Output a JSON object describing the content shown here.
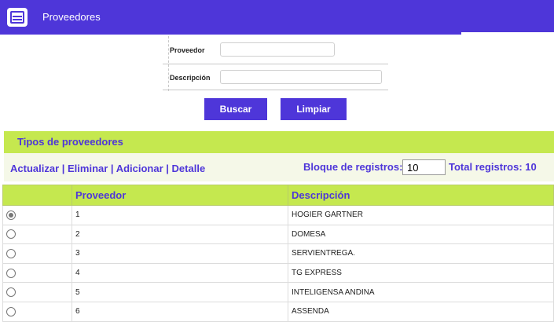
{
  "header": {
    "title": "Proveedores",
    "icon": "menu-document-icon",
    "color": "#4e36d9"
  },
  "form": {
    "proveedor_label": "Proveedor",
    "proveedor_value": "",
    "descripcion_label": "Descripción",
    "descripcion_value": ""
  },
  "buttons": {
    "search_label": "Buscar",
    "clear_label": "Limpiar"
  },
  "section": {
    "title": "Tipos de proveedores",
    "accent": "#c5e84f"
  },
  "toolbar": {
    "actions": [
      "Actualizar",
      "Eliminar",
      "Adicionar",
      "Detalle"
    ],
    "block_label": "Bloque de registros:",
    "block_value": "10",
    "total_label": "Total registros: 10"
  },
  "table": {
    "columns": [
      "",
      "Proveedor",
      "Descripción"
    ],
    "rows": [
      {
        "selected": true,
        "proveedor": "1",
        "descripcion": "HOGIER GARTNER"
      },
      {
        "selected": false,
        "proveedor": "2",
        "descripcion": "DOMESA"
      },
      {
        "selected": false,
        "proveedor": "3",
        "descripcion": "SERVIENTREGA."
      },
      {
        "selected": false,
        "proveedor": "4",
        "descripcion": "TG EXPRESS"
      },
      {
        "selected": false,
        "proveedor": "5",
        "descripcion": "INTELIGENSA ANDINA"
      },
      {
        "selected": false,
        "proveedor": "6",
        "descripcion": "ASSENDA"
      }
    ]
  }
}
